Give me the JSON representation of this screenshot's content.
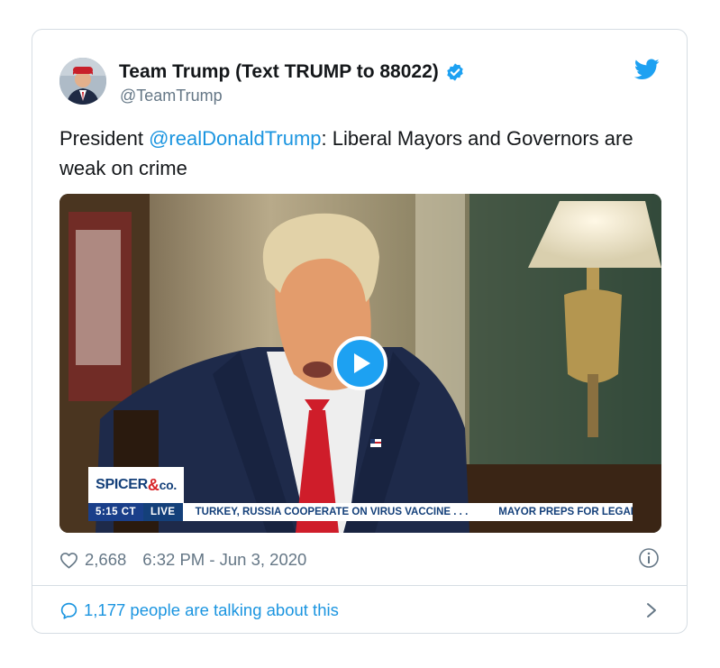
{
  "tweet": {
    "display_name": "Team Trump (Text TRUMP to 88022)",
    "handle": "@TeamTrump",
    "text_before": "President ",
    "mention": "@realDonaldTrump",
    "text_after": ": Liberal Mayors and Governors are weak on crime",
    "likes": "2,668",
    "timestamp": "6:32 PM - Jun 3, 2020",
    "conversation": "1,177 people are talking about this"
  },
  "video": {
    "logo_main": "SPICER",
    "logo_amp": "&",
    "logo_co": "co.",
    "ticker_time": "5:15 CT",
    "ticker_live": "LIVE",
    "ticker_headline": "TURKEY, RUSSIA COOPERATE ON VIRUS VACCINE . . .",
    "ticker_headline2": "MAYOR PREPS FOR LEGAL CH"
  },
  "icons": {
    "verified": "verified-badge-icon",
    "bird": "twitter-bird-icon",
    "play": "play-icon",
    "heart": "heart-icon",
    "info": "info-icon",
    "bubble": "speech-bubble-icon",
    "chevron": "chevron-right-icon"
  },
  "colors": {
    "accent": "#1da1f2",
    "link": "#1b95e0",
    "text": "#14171a",
    "muted": "#657786",
    "border": "#d6dde3"
  }
}
